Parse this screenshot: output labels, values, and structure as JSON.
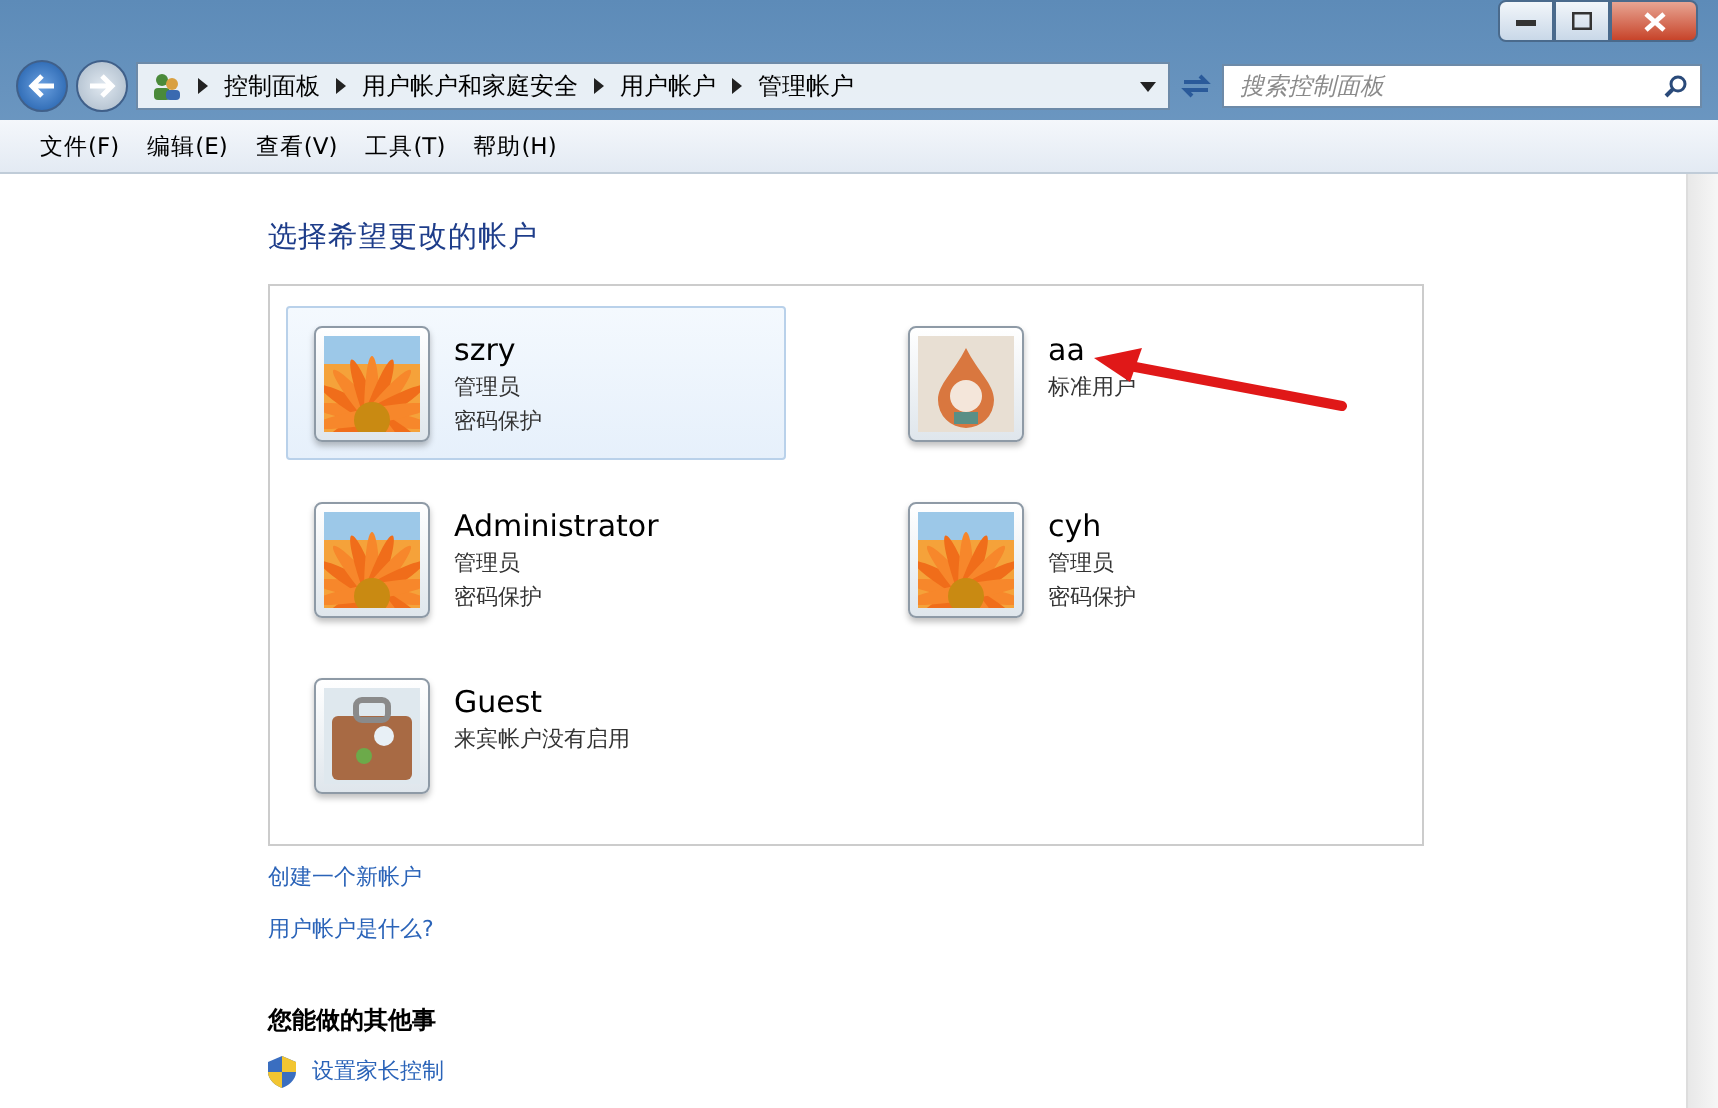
{
  "breadcrumb": [
    "控制面板",
    "用户帐户和家庭安全",
    "用户帐户",
    "管理帐户"
  ],
  "search": {
    "placeholder": "搜索控制面板"
  },
  "menu": [
    "文件(F)",
    "编辑(E)",
    "查看(V)",
    "工具(T)",
    "帮助(H)"
  ],
  "heading": "选择希望更改的帐户",
  "accounts": [
    {
      "name": "szry",
      "lines": [
        "管理员",
        "密码保护"
      ],
      "selected": true
    },
    {
      "name": "aa",
      "lines": [
        "标准用户"
      ],
      "selected": false
    },
    {
      "name": "Administrator",
      "lines": [
        "管理员",
        "密码保护"
      ],
      "selected": false
    },
    {
      "name": "cyh",
      "lines": [
        "管理员",
        "密码保护"
      ],
      "selected": false
    },
    {
      "name": "Guest",
      "lines": [
        "来宾帐户没有启用"
      ],
      "selected": false
    }
  ],
  "links": [
    "创建一个新帐户",
    "用户帐户是什么?"
  ],
  "other_tasks": {
    "title": "您能做的其他事",
    "items": [
      "设置家长控制"
    ]
  }
}
